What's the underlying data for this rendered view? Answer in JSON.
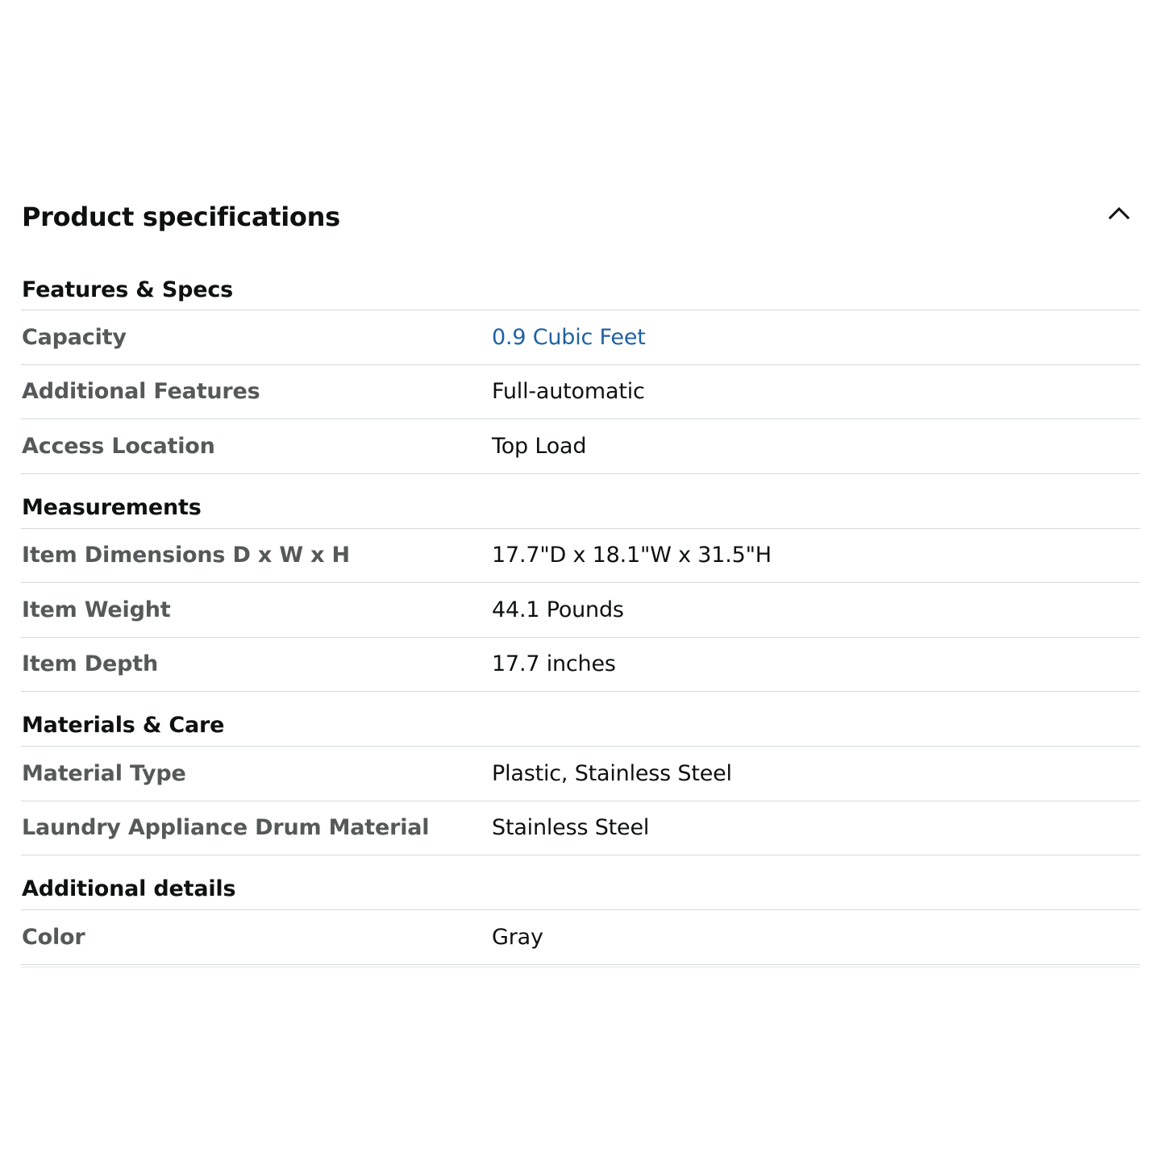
{
  "panel": {
    "title": "Product specifications",
    "toggle_icon": "chevron-up-icon"
  },
  "sections": [
    {
      "title": "Features & Specs",
      "rows": [
        {
          "label": "Capacity",
          "value": "0.9 Cubic Feet",
          "is_link": true
        },
        {
          "label": "Additional Features",
          "value": "Full-automatic",
          "is_link": false
        },
        {
          "label": "Access Location",
          "value": "Top Load",
          "is_link": false
        }
      ]
    },
    {
      "title": "Measurements",
      "rows": [
        {
          "label": "Item Dimensions D x W x H",
          "value": "17.7\"D x 18.1\"W x 31.5\"H",
          "is_link": false
        },
        {
          "label": "Item Weight",
          "value": "44.1 Pounds",
          "is_link": false
        },
        {
          "label": "Item Depth",
          "value": "17.7 inches",
          "is_link": false
        }
      ]
    },
    {
      "title": "Materials & Care",
      "rows": [
        {
          "label": "Material Type",
          "value": "Plastic, Stainless Steel",
          "is_link": false
        },
        {
          "label": "Laundry Appliance Drum Material",
          "value": "Stainless Steel",
          "is_link": false
        }
      ]
    },
    {
      "title": "Additional details",
      "rows": [
        {
          "label": "Color",
          "value": "Gray",
          "is_link": false
        }
      ]
    }
  ],
  "colors": {
    "heading": "#0f1111",
    "label": "#565959",
    "value": "#0f1111",
    "link": "#2162a1",
    "divider": "#d5d9d9"
  }
}
